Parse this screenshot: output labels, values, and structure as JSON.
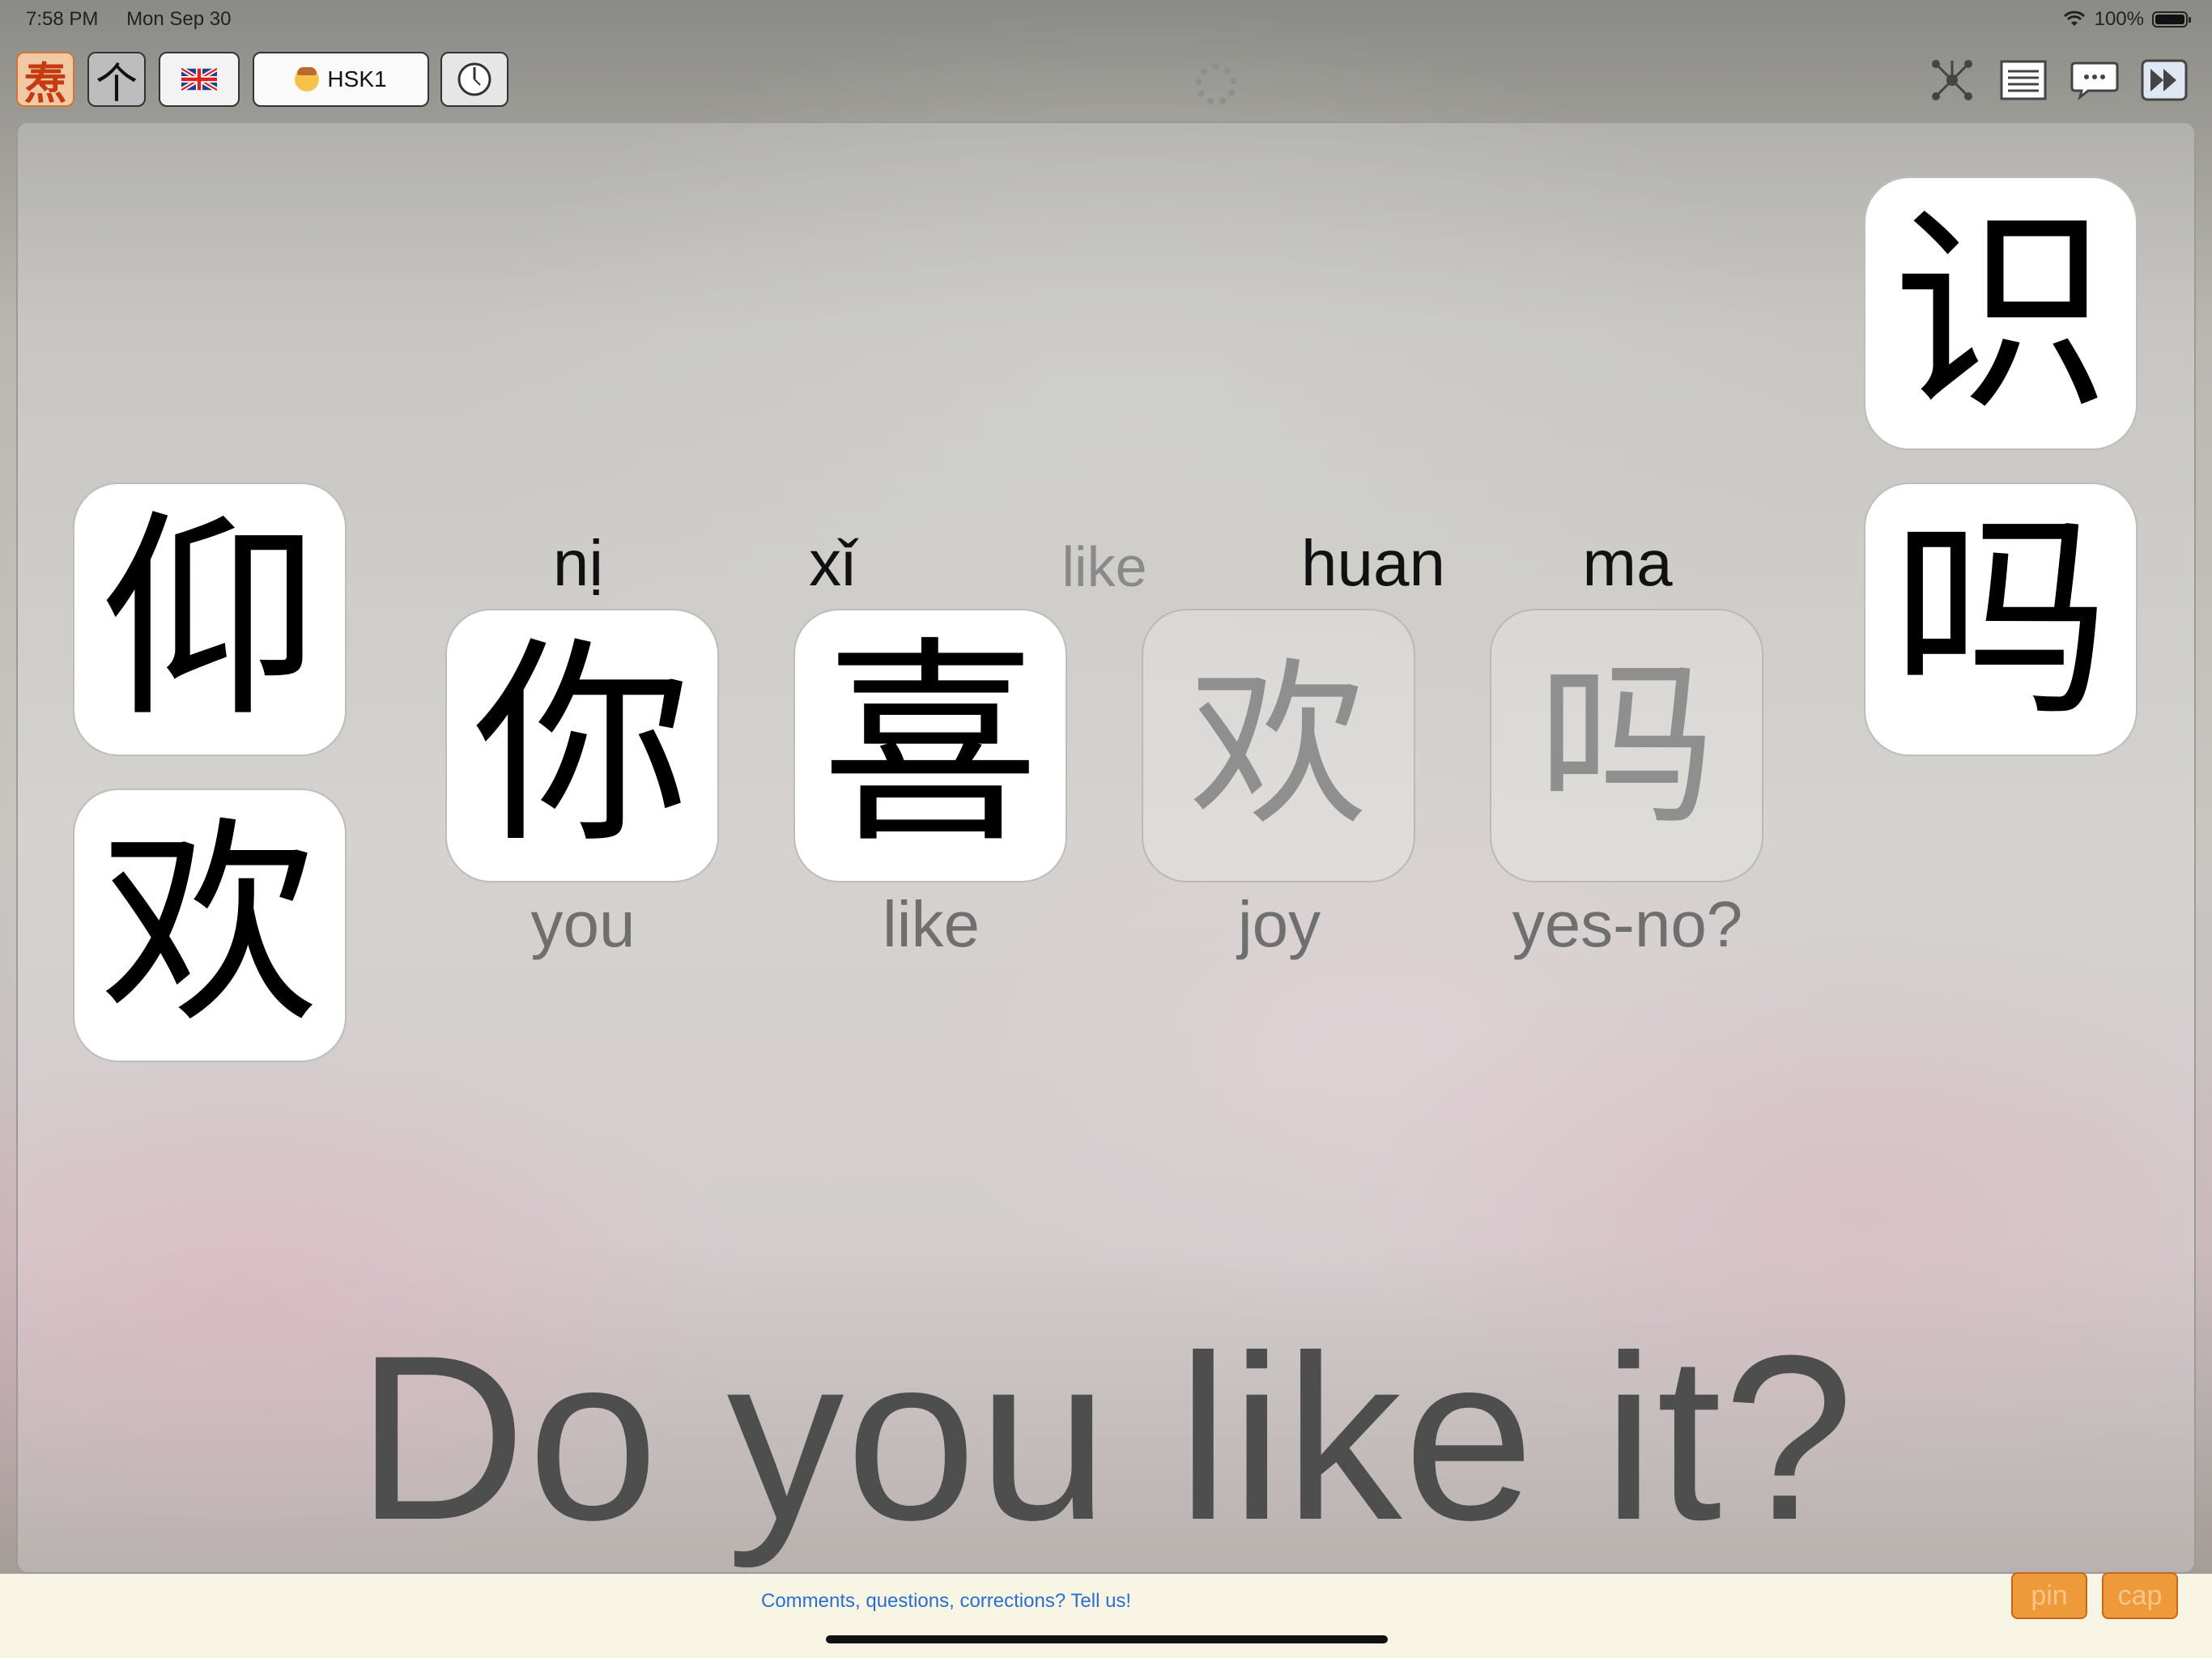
{
  "status": {
    "time": "7:58 PM",
    "date": "Mon Sep 30",
    "battery_text": "100%"
  },
  "toolbar": {
    "logo_char": "焘",
    "ge_char": "个",
    "level_label": "HSK1",
    "flag": "uk-flag-icon",
    "right_icons": [
      "network-icon",
      "list-icon",
      "speech-bubble-icon",
      "fast-forward-icon"
    ]
  },
  "left_tiles": [
    "仰",
    "欢"
  ],
  "right_tiles": [
    "识",
    "吗"
  ],
  "words": [
    {
      "char": "你",
      "pinyin": "nị",
      "gloss": "you",
      "faded": false
    },
    {
      "char": "喜",
      "pinyin": "xǐ",
      "gloss": "like",
      "faded": false
    },
    {
      "char": "欢",
      "pinyin": "huan",
      "gloss": "joy",
      "faded": true
    },
    {
      "char": "吗",
      "pinyin": "ma",
      "gloss": "yes-no?",
      "faded": true
    }
  ],
  "compound_gloss": "like",
  "sentence": "Do you like it?",
  "footer": {
    "feedback_link": "Comments, questions, corrections? Tell us!",
    "pin_label": "pin",
    "cap_label": "cap"
  },
  "colors": {
    "accent_orange": "#ee9a3a",
    "link_blue": "#2a6fd0",
    "sentence_gray": "#4e4e4e"
  }
}
